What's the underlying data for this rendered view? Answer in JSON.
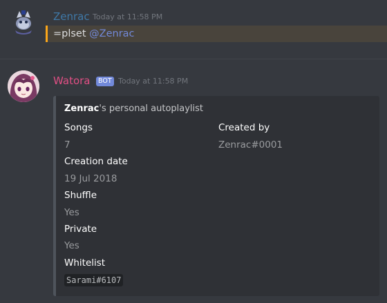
{
  "messages": [
    {
      "username": "Zenrac",
      "timestamp": "Today at 11:58 PM",
      "content_text": "=plset",
      "mention": "@Zenrac"
    },
    {
      "username": "Watora",
      "bot_tag": "BOT",
      "timestamp": "Today at 11:58 PM",
      "embed": {
        "title_name": "Zenrac",
        "title_rest": "'s personal autoplaylist",
        "fields": {
          "songs": {
            "name": "Songs",
            "value": "7"
          },
          "created_by": {
            "name": "Created by",
            "value": "Zenrac#0001"
          },
          "creation_date": {
            "name": "Creation date",
            "value": "19 Jul 2018"
          },
          "shuffle": {
            "name": "Shuffle",
            "value": "Yes"
          },
          "private": {
            "name": "Private",
            "value": "Yes"
          },
          "whitelist": {
            "name": "Whitelist",
            "value": "Sarami#6107"
          }
        }
      }
    }
  ],
  "colors": {
    "background": "#36393f",
    "mention_highlight": "#49443c",
    "mention_bar": "#faa61a",
    "zenrac_name": "#3f79a8",
    "watora_name": "#e04f84",
    "bot_badge": "#7289da",
    "embed_bg": "#2f3136"
  }
}
